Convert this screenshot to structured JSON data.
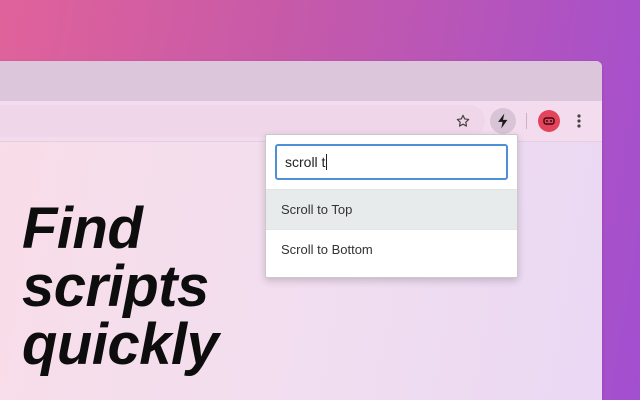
{
  "headline": {
    "lines": [
      "Find",
      "scripts",
      "quickly"
    ]
  },
  "toolbar": {
    "star_icon": "star-icon",
    "extension_icon": "lightning-bolt-icon",
    "avatar_color": "#e3445b",
    "more_icon": "vertical-dots-icon"
  },
  "popup": {
    "search_value": "scroll t",
    "results": [
      {
        "label": "Scroll to Top",
        "highlighted": true
      },
      {
        "label": "Scroll to Bottom",
        "highlighted": false
      }
    ]
  },
  "colors": {
    "focus_border": "#4d90d8",
    "highlight_row": "#e8ebeb"
  }
}
